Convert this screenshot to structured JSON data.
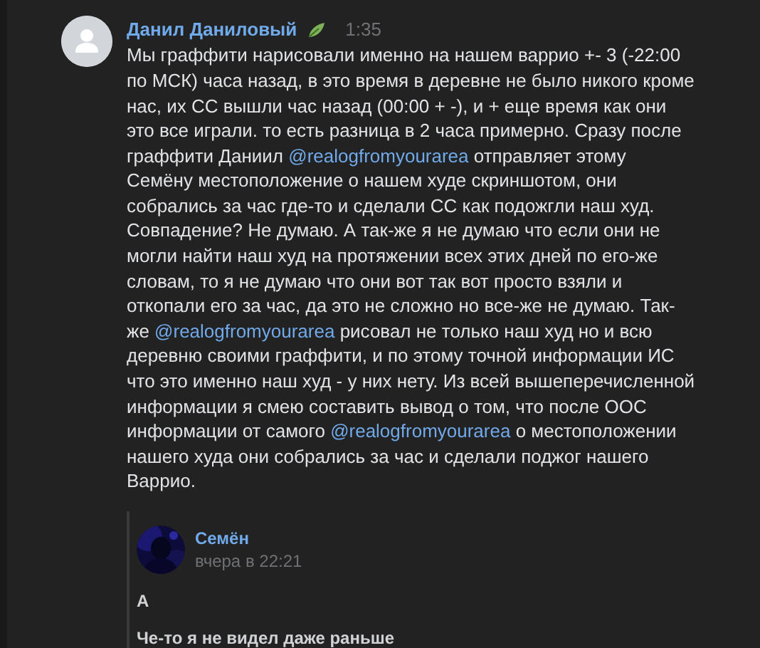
{
  "post": {
    "author": "Данил Даниловый",
    "time": "1:35",
    "body": [
      {
        "kind": "text",
        "text": "Мы граффити нарисовали именно на нашем варрио +- 3 (-22:00 по МСК) часа назад, в это время в деревне не было никого кроме нас, их СС вышли час назад (00:00 + -), и + еще время как они это все играли. то есть разница в 2 часа примерно. Сразу после граффити Даниил "
      },
      {
        "kind": "mention",
        "text": "@realogfromyourarea"
      },
      {
        "kind": "text",
        "text": " отправляет этому Семёну местоположение о нашем худе скриншотом, они собрались за час где-то и сделали СС как подожгли наш худ. Совпадение? Не думаю. А так-же я не думаю что если они не могли найти наш худ на протяжении всех этих дней по его-же словам, то я не думаю что они вот так вот просто взяли и откопали его за час, да это не сложно но все-же не думаю. Так-же "
      },
      {
        "kind": "mention",
        "text": "@realogfromyourarea"
      },
      {
        "kind": "text",
        "text": " рисовал не только наш худ но и всю деревню своими граффити, и по этому точной информации ИС что это именно наш худ - у них нету. Из всей вышеперечисленной информации я смею составить вывод о том, что после ООС информации от самого "
      },
      {
        "kind": "mention",
        "text": "@realogfromyourarea"
      },
      {
        "kind": "text",
        "text": " о местоположении нашего худа они собрались за час и сделали поджог нашего Варрио."
      }
    ],
    "quote": {
      "author": "Семён",
      "time": "вчера в 22:21",
      "lines": [
        "А",
        "Че-то я не видел даже раньше"
      ]
    }
  }
}
